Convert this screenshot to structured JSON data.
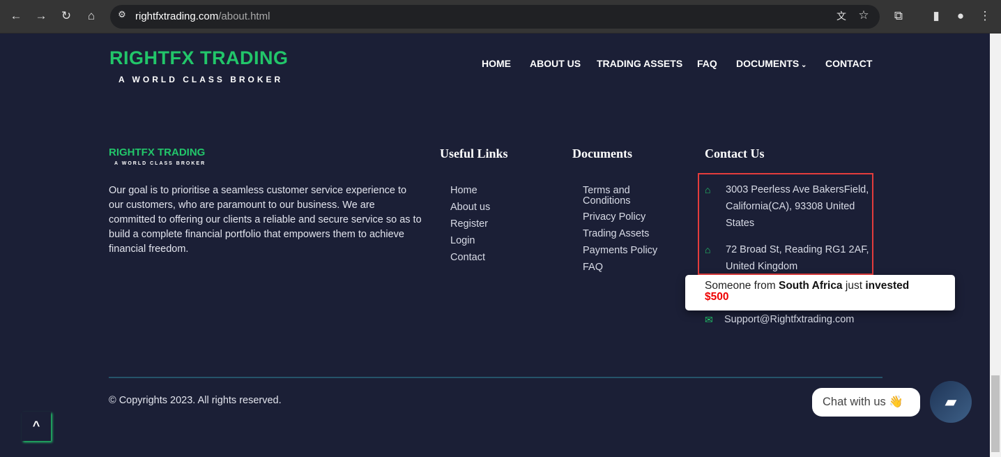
{
  "browser": {
    "url_host": "rightfxtrading.com",
    "url_path": "/about.html",
    "icons": [
      "back-icon",
      "forward-icon",
      "reload-icon",
      "home-icon",
      "site-info-icon",
      "translate-icon",
      "star-icon",
      "extensions-icon",
      "sidebar-icon",
      "profile-icon",
      "menu-icon"
    ]
  },
  "header": {
    "logo_title": "RIGHTFX TRADING",
    "logo_tagline": "A WORLD CLASS BROKER",
    "nav": [
      "HOME",
      "ABOUT US",
      "TRADING ASSETS",
      "FAQ",
      "DOCUMENTS",
      "CONTACT"
    ]
  },
  "footer": {
    "logo_title": "RIGHTFX TRADING",
    "logo_tagline": "A WORLD CLASS BROKER",
    "about": "Our goal is to prioritise a seamless customer service experience to our customers, who are paramount to our business. We are committed to offering our clients a reliable and secure service so as to build a complete financial portfolio that empowers them to achieve financial freedom.",
    "useful_links_title": "Useful Links",
    "useful_links": [
      "Home",
      "About us",
      "Register",
      "Login",
      "Contact"
    ],
    "documents_title": "Documents",
    "documents": [
      "Terms and Conditions",
      "Privacy Policy",
      "Trading Assets",
      "Payments Policy",
      "FAQ"
    ],
    "contact_title": "Contact Us",
    "address1": "3003 Peerless Ave BakersField, California(CA), 93308 United States",
    "address2": "72 Broad St, Reading RG1 2AF, United Kingdom",
    "email": "Support@Rightfxtrading.com",
    "copyright": "© Copyrights 2023. All rights reserved."
  },
  "toast": {
    "prefix": "Someone from",
    "country": "South Africa",
    "middle": "just",
    "action": "invested",
    "amount": "$500"
  },
  "chat": {
    "label": "Chat with us",
    "emoji": "👋"
  },
  "colors": {
    "background": "#1b1f36",
    "accent": "#22c66a",
    "highlight_box": "#e43c3c"
  }
}
